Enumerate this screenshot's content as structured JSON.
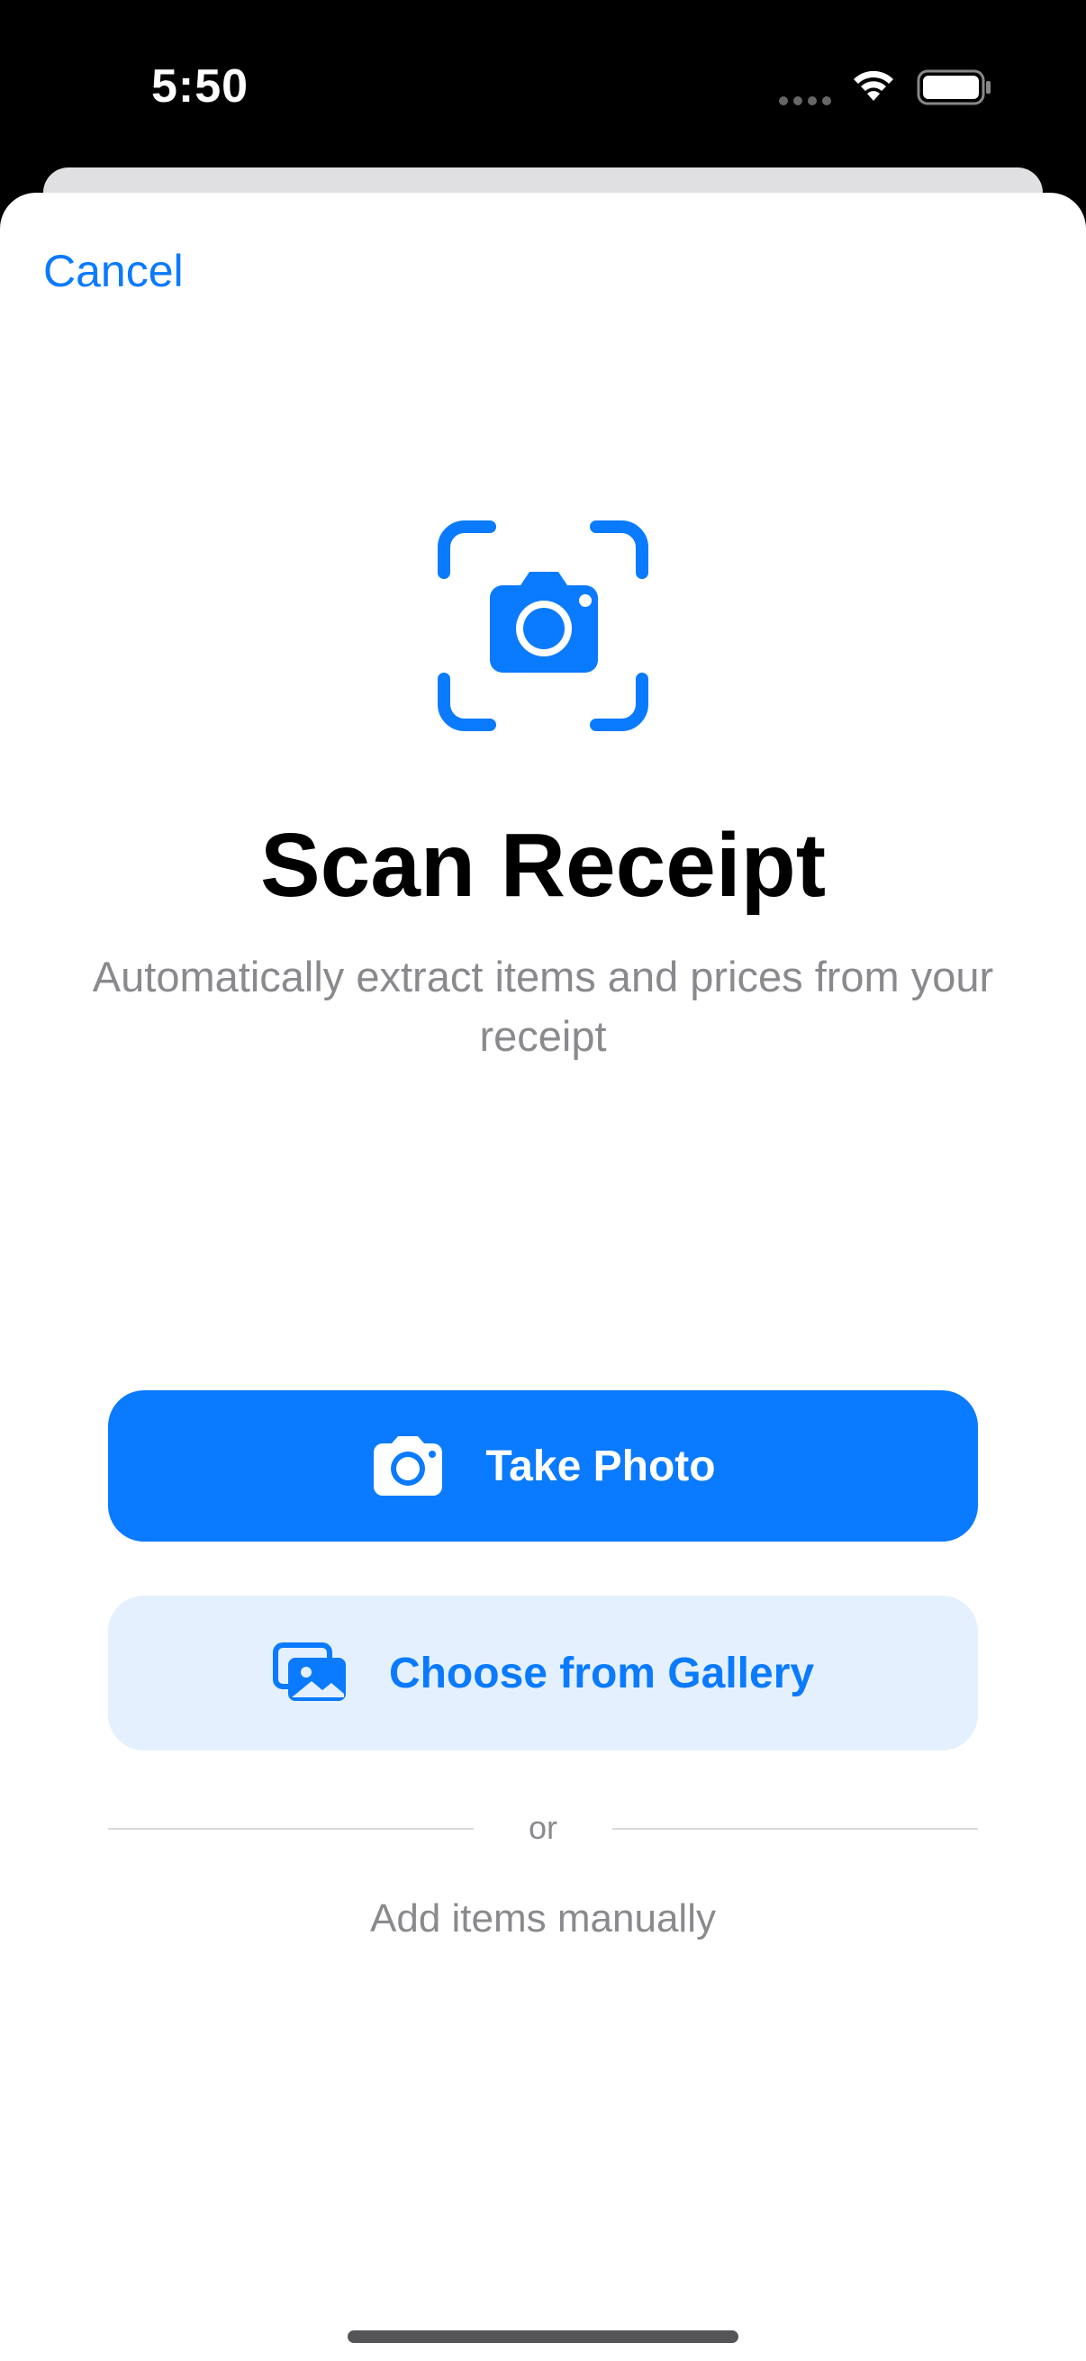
{
  "status_bar": {
    "time": "5:50"
  },
  "header": {
    "cancel_label": "Cancel"
  },
  "main": {
    "title": "Scan Receipt",
    "subtitle": "Automatically extract items and prices from your receipt"
  },
  "actions": {
    "take_photo_label": "Take Photo",
    "gallery_label": "Choose from Gallery",
    "divider_label": "or",
    "manual_label": "Add items manually"
  },
  "colors": {
    "accent": "#0a7aff",
    "secondary_button_bg": "#e4f0fd",
    "muted_text": "#8a8a8e"
  },
  "icons": {
    "scan": "camera-viewfinder-icon",
    "take_photo": "camera-icon",
    "gallery": "photo-stack-icon"
  }
}
